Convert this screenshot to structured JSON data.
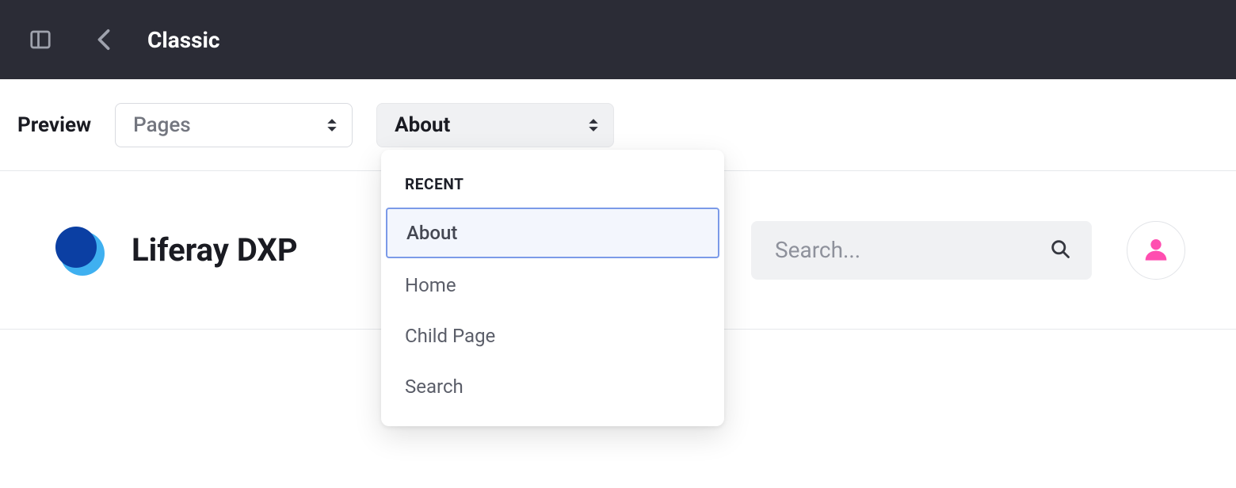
{
  "topbar": {
    "title": "Classic"
  },
  "controls": {
    "preview_label": "Preview",
    "pages_select": {
      "label": "Pages"
    },
    "page_select": {
      "label": "About"
    }
  },
  "dropdown": {
    "header": "RECENT",
    "items": [
      {
        "label": "About",
        "selected": true
      },
      {
        "label": "Home",
        "selected": false
      },
      {
        "label": "Child Page",
        "selected": false
      },
      {
        "label": "Search",
        "selected": false
      }
    ]
  },
  "site": {
    "title": "Liferay DXP",
    "search_placeholder": "Search..."
  }
}
